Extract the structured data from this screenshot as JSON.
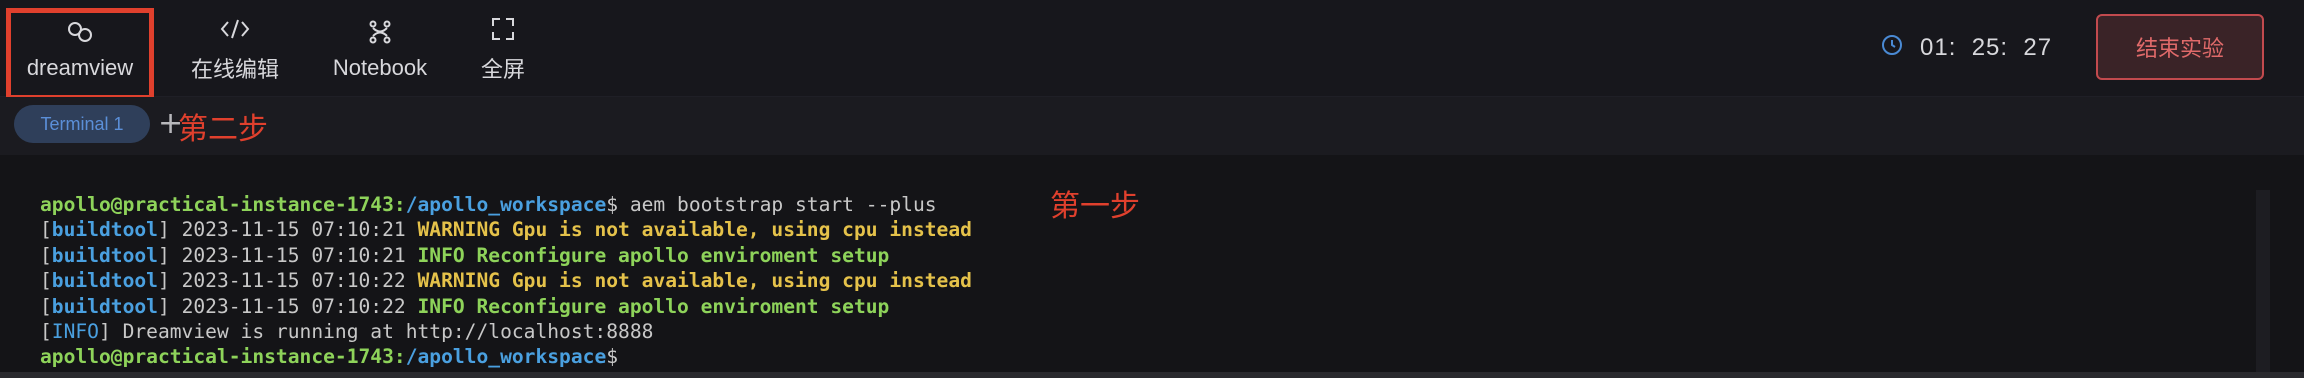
{
  "toolbar": {
    "items": [
      {
        "label": "dreamview",
        "icon": "link-icon"
      },
      {
        "label": "在线编辑",
        "icon": "code-icon"
      },
      {
        "label": "Notebook",
        "icon": "notebook-icon"
      },
      {
        "label": "全屏",
        "icon": "fullscreen-icon"
      }
    ],
    "timer": "01:  25:  27",
    "end_button": "结束实验"
  },
  "tabs": {
    "active": "Terminal 1",
    "add": "+"
  },
  "annotations": {
    "step1": "第一步",
    "step2": "第二步"
  },
  "terminal": {
    "prompt_user": "apollo@practical-instance-1743",
    "colon": ":",
    "prompt_path": "/apollo_workspace",
    "prompt_symbol": "$",
    "command": " aem bootstrap start --plus",
    "log": [
      {
        "tag": "buildtool",
        "time": "2023-11-15 07:10:21",
        "msg": "WARNING Gpu is not available, using cpu instead",
        "level": "warning"
      },
      {
        "tag": "buildtool",
        "time": "2023-11-15 07:10:21",
        "msg": "INFO Reconfigure apollo enviroment setup",
        "level": "info"
      },
      {
        "tag": "buildtool",
        "time": "2023-11-15 07:10:22",
        "msg": "WARNING Gpu is not available, using cpu instead",
        "level": "warning"
      },
      {
        "tag": "buildtool",
        "time": "2023-11-15 07:10:22",
        "msg": "INFO Reconfigure apollo enviroment setup",
        "level": "info"
      }
    ],
    "info_tag": "INFO",
    "info_msg": " Dreamview is running at http://localhost:8888"
  },
  "colors": {
    "accent_red": "#e0402d",
    "prompt_green": "#8ed35a",
    "path_blue": "#4aa0e0",
    "warning_yellow": "#e5c24a"
  }
}
